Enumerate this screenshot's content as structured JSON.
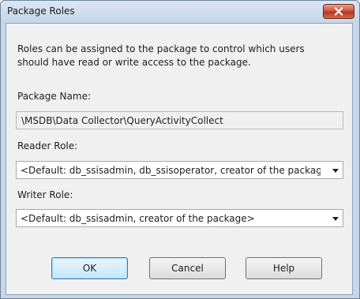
{
  "window": {
    "title": "Package Roles"
  },
  "description": {
    "line1": "Roles can be assigned to the package to control which users",
    "line2": "should have read or write access to the package."
  },
  "package_name": {
    "label": "Package Name:",
    "value": "\\MSDB\\Data Collector\\QueryActivityCollect"
  },
  "reader_role": {
    "label": "Reader Role:",
    "selected": "<Default: db_ssisadmin, db_ssisoperator, creator of the package"
  },
  "writer_role": {
    "label": "Writer Role:",
    "selected": "<Default: db_ssisadmin, creator of the package>"
  },
  "buttons": {
    "ok": "OK",
    "cancel": "Cancel",
    "help": "Help"
  },
  "colors": {
    "close_button": "#c94a2f",
    "default_button_border": "#3c7fb1"
  }
}
